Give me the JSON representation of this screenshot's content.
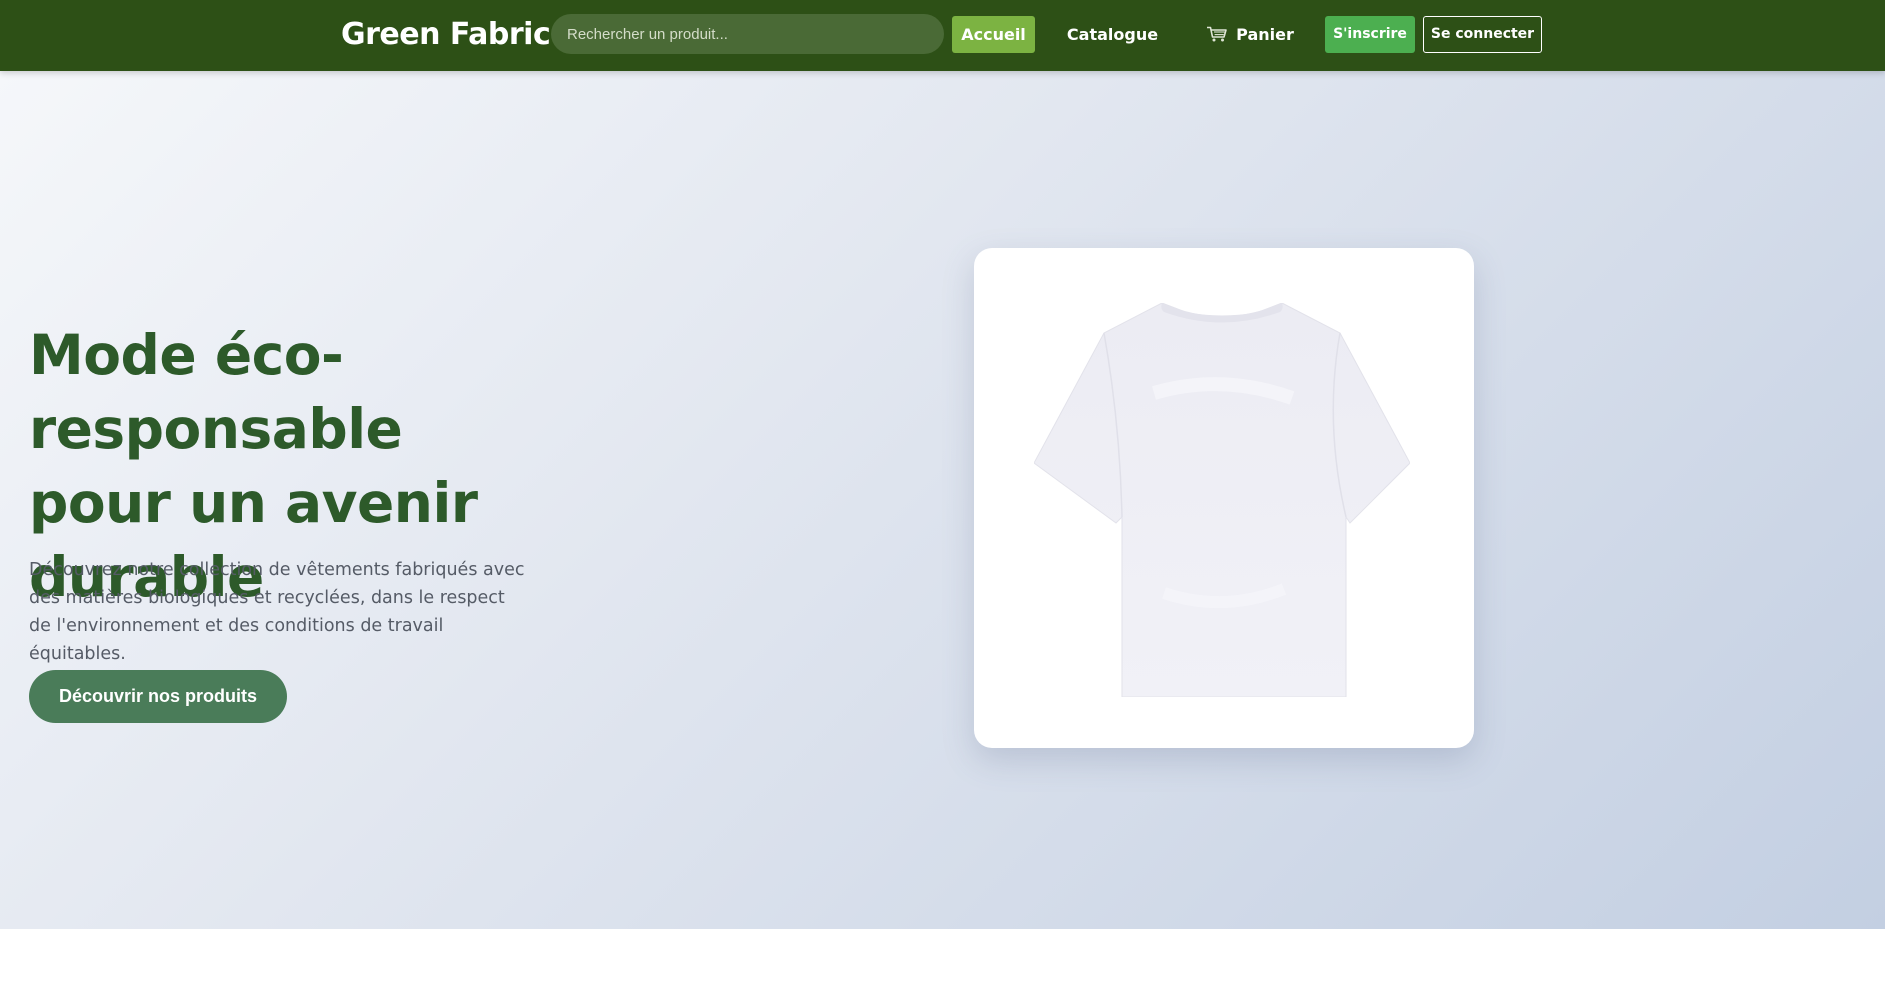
{
  "header": {
    "brand": "Green Fabric",
    "search_placeholder": "Rechercher un produit...",
    "nav": {
      "home": "Accueil",
      "catalog": "Catalogue",
      "cart": "Panier",
      "signup": "S'inscrire",
      "login": "Se connecter"
    },
    "cart_icon": "cart-icon",
    "active_item": "home",
    "colors": {
      "navbar_bg": "#2d5016",
      "active_bg": "#7cb342",
      "signup_bg": "#4caf50"
    }
  },
  "hero": {
    "title": "Mode éco-responsable pour un avenir durable",
    "description": "Découvrez notre collection de vêtements fabriqués avec des matières biologiques et recyclées, dans le respect de l'environnement et des conditions de travail équitables.",
    "cta_label": "Découvrir nos produits",
    "image_icon": "tshirt-image",
    "colors": {
      "title": "#2d5a2a",
      "cta_bg": "#4a7c59",
      "gradient_start": "#f5f7fa",
      "gradient_end": "#c3cfe2"
    }
  }
}
